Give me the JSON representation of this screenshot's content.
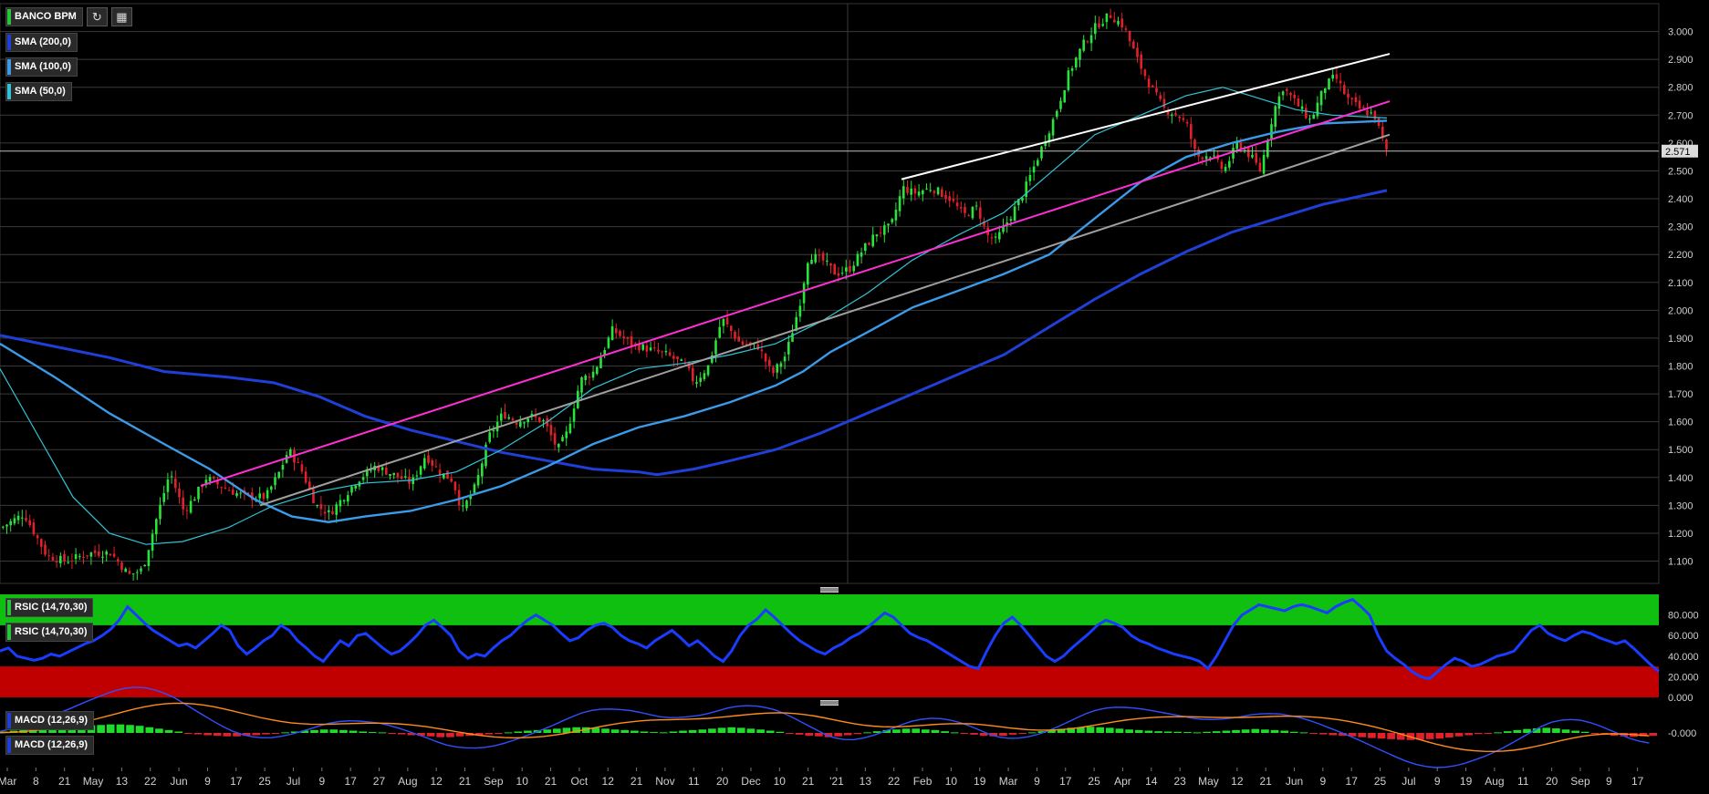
{
  "symbol": "BANCO BPM",
  "last_price": "2.571",
  "overlays": [
    {
      "label": "SMA (200,0)",
      "color": "#1f3fd6"
    },
    {
      "label": "SMA (100,0)",
      "color": "#3b9be8"
    },
    {
      "label": "SMA (50,0)",
      "color": "#31c4d8"
    }
  ],
  "rsi_labels": [
    "RSIC (14,70,30)",
    "RSIC (14,70,30)"
  ],
  "macd_labels": [
    "MACD (12,26,9)",
    "MACD (12,26,9)"
  ],
  "toolbar": {
    "refresh_icon": "refresh-icon",
    "calendar_icon": "calendar-icon"
  },
  "chart_data": [
    {
      "type": "candlestick",
      "title": "BANCO BPM",
      "ylim": [
        1.02,
        3.1
      ],
      "yticks": [
        "1.100",
        "1.200",
        "1.300",
        "1.400",
        "1.500",
        "1.600",
        "1.700",
        "1.800",
        "1.900",
        "2.000",
        "2.100",
        "2.200",
        "2.300",
        "2.400",
        "2.500",
        "2.600",
        "2.700",
        "2.800",
        "2.900",
        "3.000"
      ],
      "x_labels": [
        "Mar",
        "8",
        "21",
        "May",
        "13",
        "22",
        "Jun",
        "9",
        "17",
        "25",
        "Jul",
        "9",
        "17",
        "27",
        "Aug",
        "12",
        "21",
        "Sep",
        "10",
        "21",
        "Oct",
        "12",
        "21",
        "Nov",
        "11",
        "20",
        "Dec",
        "10",
        "21",
        "'21",
        "13",
        "22",
        "Feb",
        "10",
        "19",
        "Mar",
        "9",
        "17",
        "25",
        "Apr",
        "14",
        "23",
        "May",
        "12",
        "21",
        "Jun",
        "9",
        "17",
        "25",
        "Jul",
        "9",
        "19",
        "Aug",
        "11",
        "20",
        "Sep",
        "9",
        "17"
      ],
      "close_path": [
        [
          0,
          1.22
        ],
        [
          25,
          1.27
        ],
        [
          50,
          1.12
        ],
        [
          70,
          1.1
        ],
        [
          100,
          1.13
        ],
        [
          120,
          1.13
        ],
        [
          140,
          1.05
        ],
        [
          155,
          1.07
        ],
        [
          170,
          1.25
        ],
        [
          185,
          1.42
        ],
        [
          200,
          1.28
        ],
        [
          210,
          1.32
        ],
        [
          225,
          1.4
        ],
        [
          240,
          1.37
        ],
        [
          260,
          1.34
        ],
        [
          275,
          1.33
        ],
        [
          290,
          1.33
        ],
        [
          305,
          1.42
        ],
        [
          315,
          1.5
        ],
        [
          330,
          1.42
        ],
        [
          345,
          1.3
        ],
        [
          360,
          1.27
        ],
        [
          375,
          1.33
        ],
        [
          390,
          1.39
        ],
        [
          410,
          1.44
        ],
        [
          430,
          1.41
        ],
        [
          450,
          1.38
        ],
        [
          465,
          1.48
        ],
        [
          480,
          1.42
        ],
        [
          495,
          1.39
        ],
        [
          505,
          1.28
        ],
        [
          520,
          1.37
        ],
        [
          535,
          1.55
        ],
        [
          550,
          1.63
        ],
        [
          565,
          1.6
        ],
        [
          580,
          1.62
        ],
        [
          595,
          1.6
        ],
        [
          610,
          1.5
        ],
        [
          620,
          1.56
        ],
        [
          635,
          1.75
        ],
        [
          650,
          1.78
        ],
        [
          670,
          1.93
        ],
        [
          690,
          1.88
        ],
        [
          710,
          1.86
        ],
        [
          730,
          1.84
        ],
        [
          750,
          1.8
        ],
        [
          760,
          1.74
        ],
        [
          775,
          1.8
        ],
        [
          790,
          1.97
        ],
        [
          810,
          1.88
        ],
        [
          830,
          1.87
        ],
        [
          845,
          1.77
        ],
        [
          860,
          1.84
        ],
        [
          875,
          2.02
        ],
        [
          885,
          2.2
        ],
        [
          900,
          2.18
        ],
        [
          915,
          2.13
        ],
        [
          930,
          2.15
        ],
        [
          945,
          2.22
        ],
        [
          960,
          2.28
        ],
        [
          975,
          2.3
        ],
        [
          988,
          2.44
        ],
        [
          1000,
          2.42
        ],
        [
          1020,
          2.44
        ],
        [
          1040,
          2.4
        ],
        [
          1055,
          2.34
        ],
        [
          1070,
          2.37
        ],
        [
          1080,
          2.27
        ],
        [
          1090,
          2.25
        ],
        [
          1105,
          2.33
        ],
        [
          1120,
          2.42
        ],
        [
          1140,
          2.58
        ],
        [
          1155,
          2.7
        ],
        [
          1170,
          2.85
        ],
        [
          1185,
          2.95
        ],
        [
          1200,
          3.02
        ],
        [
          1215,
          3.06
        ],
        [
          1230,
          3.02
        ],
        [
          1245,
          2.9
        ],
        [
          1260,
          2.8
        ],
        [
          1275,
          2.72
        ],
        [
          1290,
          2.7
        ],
        [
          1300,
          2.66
        ],
        [
          1310,
          2.55
        ],
        [
          1325,
          2.56
        ],
        [
          1340,
          2.5
        ],
        [
          1355,
          2.6
        ],
        [
          1370,
          2.55
        ],
        [
          1380,
          2.5
        ],
        [
          1395,
          2.72
        ],
        [
          1405,
          2.8
        ],
        [
          1420,
          2.74
        ],
        [
          1435,
          2.68
        ],
        [
          1450,
          2.8
        ],
        [
          1462,
          2.84
        ],
        [
          1475,
          2.76
        ],
        [
          1490,
          2.72
        ],
        [
          1505,
          2.7
        ],
        [
          1515,
          2.6
        ],
        [
          1520,
          2.55
        ]
      ],
      "series": [
        {
          "name": "SMA (200,0)",
          "color": "#1f3fd6",
          "points": [
            [
              0,
              1.91
            ],
            [
              60,
              1.87
            ],
            [
              120,
              1.83
            ],
            [
              180,
              1.78
            ],
            [
              250,
              1.76
            ],
            [
              300,
              1.74
            ],
            [
              350,
              1.69
            ],
            [
              400,
              1.62
            ],
            [
              450,
              1.57
            ],
            [
              500,
              1.53
            ],
            [
              550,
              1.49
            ],
            [
              600,
              1.46
            ],
            [
              650,
              1.43
            ],
            [
              700,
              1.42
            ],
            [
              720,
              1.41
            ],
            [
              760,
              1.43
            ],
            [
              800,
              1.46
            ],
            [
              850,
              1.5
            ],
            [
              900,
              1.56
            ],
            [
              950,
              1.63
            ],
            [
              1000,
              1.7
            ],
            [
              1050,
              1.77
            ],
            [
              1100,
              1.84
            ],
            [
              1150,
              1.94
            ],
            [
              1200,
              2.04
            ],
            [
              1250,
              2.13
            ],
            [
              1300,
              2.21
            ],
            [
              1350,
              2.28
            ],
            [
              1400,
              2.33
            ],
            [
              1450,
              2.38
            ],
            [
              1520,
              2.43
            ]
          ]
        },
        {
          "name": "SMA (100,0)",
          "color": "#3b9be8",
          "points": [
            [
              0,
              1.88
            ],
            [
              60,
              1.76
            ],
            [
              120,
              1.63
            ],
            [
              180,
              1.52
            ],
            [
              230,
              1.43
            ],
            [
              280,
              1.32
            ],
            [
              320,
              1.26
            ],
            [
              360,
              1.24
            ],
            [
              400,
              1.26
            ],
            [
              450,
              1.28
            ],
            [
              500,
              1.32
            ],
            [
              550,
              1.37
            ],
            [
              600,
              1.44
            ],
            [
              650,
              1.52
            ],
            [
              700,
              1.58
            ],
            [
              750,
              1.62
            ],
            [
              800,
              1.67
            ],
            [
              850,
              1.73
            ],
            [
              880,
              1.78
            ],
            [
              910,
              1.85
            ],
            [
              950,
              1.92
            ],
            [
              1000,
              2.01
            ],
            [
              1050,
              2.07
            ],
            [
              1100,
              2.13
            ],
            [
              1150,
              2.2
            ],
            [
              1200,
              2.33
            ],
            [
              1250,
              2.46
            ],
            [
              1300,
              2.55
            ],
            [
              1350,
              2.6
            ],
            [
              1400,
              2.64
            ],
            [
              1450,
              2.67
            ],
            [
              1520,
              2.68
            ]
          ]
        },
        {
          "name": "SMA (50,0)",
          "color": "#31c4d8",
          "points": [
            [
              0,
              1.79
            ],
            [
              40,
              1.56
            ],
            [
              80,
              1.33
            ],
            [
              120,
              1.2
            ],
            [
              160,
              1.16
            ],
            [
              200,
              1.17
            ],
            [
              250,
              1.22
            ],
            [
              300,
              1.3
            ],
            [
              350,
              1.35
            ],
            [
              400,
              1.38
            ],
            [
              450,
              1.39
            ],
            [
              500,
              1.42
            ],
            [
              550,
              1.5
            ],
            [
              600,
              1.6
            ],
            [
              650,
              1.72
            ],
            [
              700,
              1.79
            ],
            [
              750,
              1.81
            ],
            [
              800,
              1.84
            ],
            [
              850,
              1.88
            ],
            [
              900,
              1.96
            ],
            [
              950,
              2.06
            ],
            [
              1000,
              2.18
            ],
            [
              1050,
              2.27
            ],
            [
              1100,
              2.35
            ],
            [
              1150,
              2.49
            ],
            [
              1200,
              2.63
            ],
            [
              1250,
              2.7
            ],
            [
              1300,
              2.77
            ],
            [
              1340,
              2.8
            ],
            [
              1380,
              2.76
            ],
            [
              1420,
              2.72
            ],
            [
              1460,
              2.7
            ],
            [
              1520,
              2.69
            ]
          ]
        }
      ],
      "trendlines": [
        {
          "color": "#ff2fd6",
          "from": [
            220,
            1.37
          ],
          "to": [
            1523,
            2.75
          ]
        },
        {
          "color": "#a0a0a0",
          "from": [
            285,
            1.3
          ],
          "to": [
            1523,
            2.63
          ]
        },
        {
          "color": "#ffffff",
          "from": [
            988,
            2.47
          ],
          "to": [
            1523,
            2.92
          ]
        }
      ]
    },
    {
      "type": "line",
      "title": "RSIC (14,70,30)",
      "ylim": [
        0,
        100
      ],
      "yticks": [
        "0.000",
        "20.000",
        "40.000",
        "60.000",
        "80.000"
      ],
      "bands": {
        "overbought": 70,
        "oversold": 30
      },
      "values": [
        45,
        48,
        40,
        38,
        36,
        38,
        42,
        40,
        44,
        48,
        52,
        55,
        60,
        66,
        75,
        88,
        80,
        72,
        65,
        60,
        55,
        50,
        52,
        48,
        55,
        62,
        70,
        65,
        50,
        42,
        48,
        55,
        60,
        70,
        65,
        55,
        48,
        40,
        35,
        45,
        55,
        50,
        60,
        62,
        55,
        48,
        42,
        45,
        52,
        60,
        70,
        75,
        68,
        60,
        45,
        38,
        42,
        40,
        48,
        55,
        60,
        68,
        75,
        80,
        75,
        70,
        62,
        55,
        58,
        65,
        70,
        72,
        68,
        60,
        55,
        52,
        48,
        55,
        60,
        65,
        58,
        50,
        55,
        48,
        40,
        35,
        45,
        60,
        70,
        76,
        85,
        78,
        70,
        62,
        55,
        50,
        45,
        42,
        48,
        52,
        58,
        62,
        68,
        75,
        82,
        78,
        70,
        62,
        58,
        55,
        50,
        45,
        40,
        35,
        30,
        28,
        45,
        60,
        72,
        78,
        70,
        60,
        50,
        40,
        35,
        40,
        48,
        55,
        62,
        70,
        75,
        72,
        68,
        60,
        55,
        52,
        48,
        45,
        42,
        40,
        38,
        35,
        28,
        40,
        55,
        70,
        80,
        85,
        90,
        88,
        86,
        84,
        88,
        90,
        88,
        85,
        82,
        88,
        92,
        95,
        88,
        80,
        60,
        45,
        38,
        32,
        25,
        20,
        18,
        25,
        32,
        38,
        35,
        30,
        32,
        36,
        40,
        42,
        45,
        55,
        65,
        70,
        62,
        58,
        55,
        60,
        64,
        62,
        58,
        55,
        52,
        55,
        48,
        40,
        32,
        25
      ]
    },
    {
      "type": "bar",
      "title": "MACD (12,26,9)",
      "ylim": [
        -0.09,
        0.09
      ],
      "yticks": [
        "-0.000"
      ],
      "histogram": [
        0.005,
        0.008,
        0.01,
        0.012,
        0.015,
        0.018,
        0.02,
        0.022,
        0.025,
        0.027,
        0.028,
        0.03,
        0.03,
        0.028,
        0.025,
        0.02,
        0.015,
        0.01,
        0.005,
        -0.002,
        -0.005,
        -0.008,
        -0.01,
        -0.012,
        -0.012,
        -0.01,
        -0.008,
        -0.005,
        -0.002,
        0.002,
        0.005,
        0.008,
        0.01,
        0.012,
        0.012,
        0.01,
        0.008,
        0.005,
        0.003,
        0.002,
        -0.002,
        -0.005,
        -0.008,
        -0.01,
        -0.012,
        -0.015,
        -0.015,
        -0.012,
        -0.01,
        -0.008,
        -0.005,
        -0.002,
        0.002,
        0.005,
        0.008,
        0.01,
        0.012,
        0.015,
        0.018,
        0.02,
        0.02,
        0.018,
        0.015,
        0.012,
        0.01,
        0.008,
        0.005,
        0.003,
        0.002,
        0.005,
        0.008,
        0.01,
        0.012,
        0.015,
        0.018,
        0.02,
        0.018,
        0.015,
        0.012,
        0.008,
        0.004,
        -0.002,
        -0.006,
        -0.01,
        -0.012,
        -0.015,
        -0.012,
        -0.008,
        -0.004,
        0.002,
        0.006,
        0.01,
        0.012,
        0.015,
        0.015,
        0.012,
        0.01,
        0.006,
        0.002,
        -0.002,
        -0.006,
        -0.01,
        -0.012,
        -0.01,
        -0.006,
        -0.002,
        0.002,
        0.006,
        0.01,
        0.014,
        0.018,
        0.02,
        0.022,
        0.02,
        0.018,
        0.015,
        0.012,
        0.01,
        0.008,
        0.006,
        0.005,
        0.004,
        0.003,
        0.002,
        0.004,
        0.006,
        0.008,
        0.01,
        0.012,
        0.014,
        0.012,
        0.01,
        0.008,
        0.004,
        0.002,
        -0.002,
        -0.005,
        -0.008,
        -0.01,
        -0.012,
        -0.015,
        -0.018,
        -0.02,
        -0.022,
        -0.024,
        -0.025,
        -0.024,
        -0.022,
        -0.02,
        -0.016,
        -0.012,
        -0.008,
        -0.004,
        -0.002,
        0.002,
        0.006,
        0.01,
        0.014,
        0.016,
        0.018,
        0.016,
        0.012,
        0.008,
        0.004,
        -0.002,
        -0.006,
        -0.01,
        -0.012,
        -0.014,
        -0.012,
        -0.01
      ]
    }
  ]
}
